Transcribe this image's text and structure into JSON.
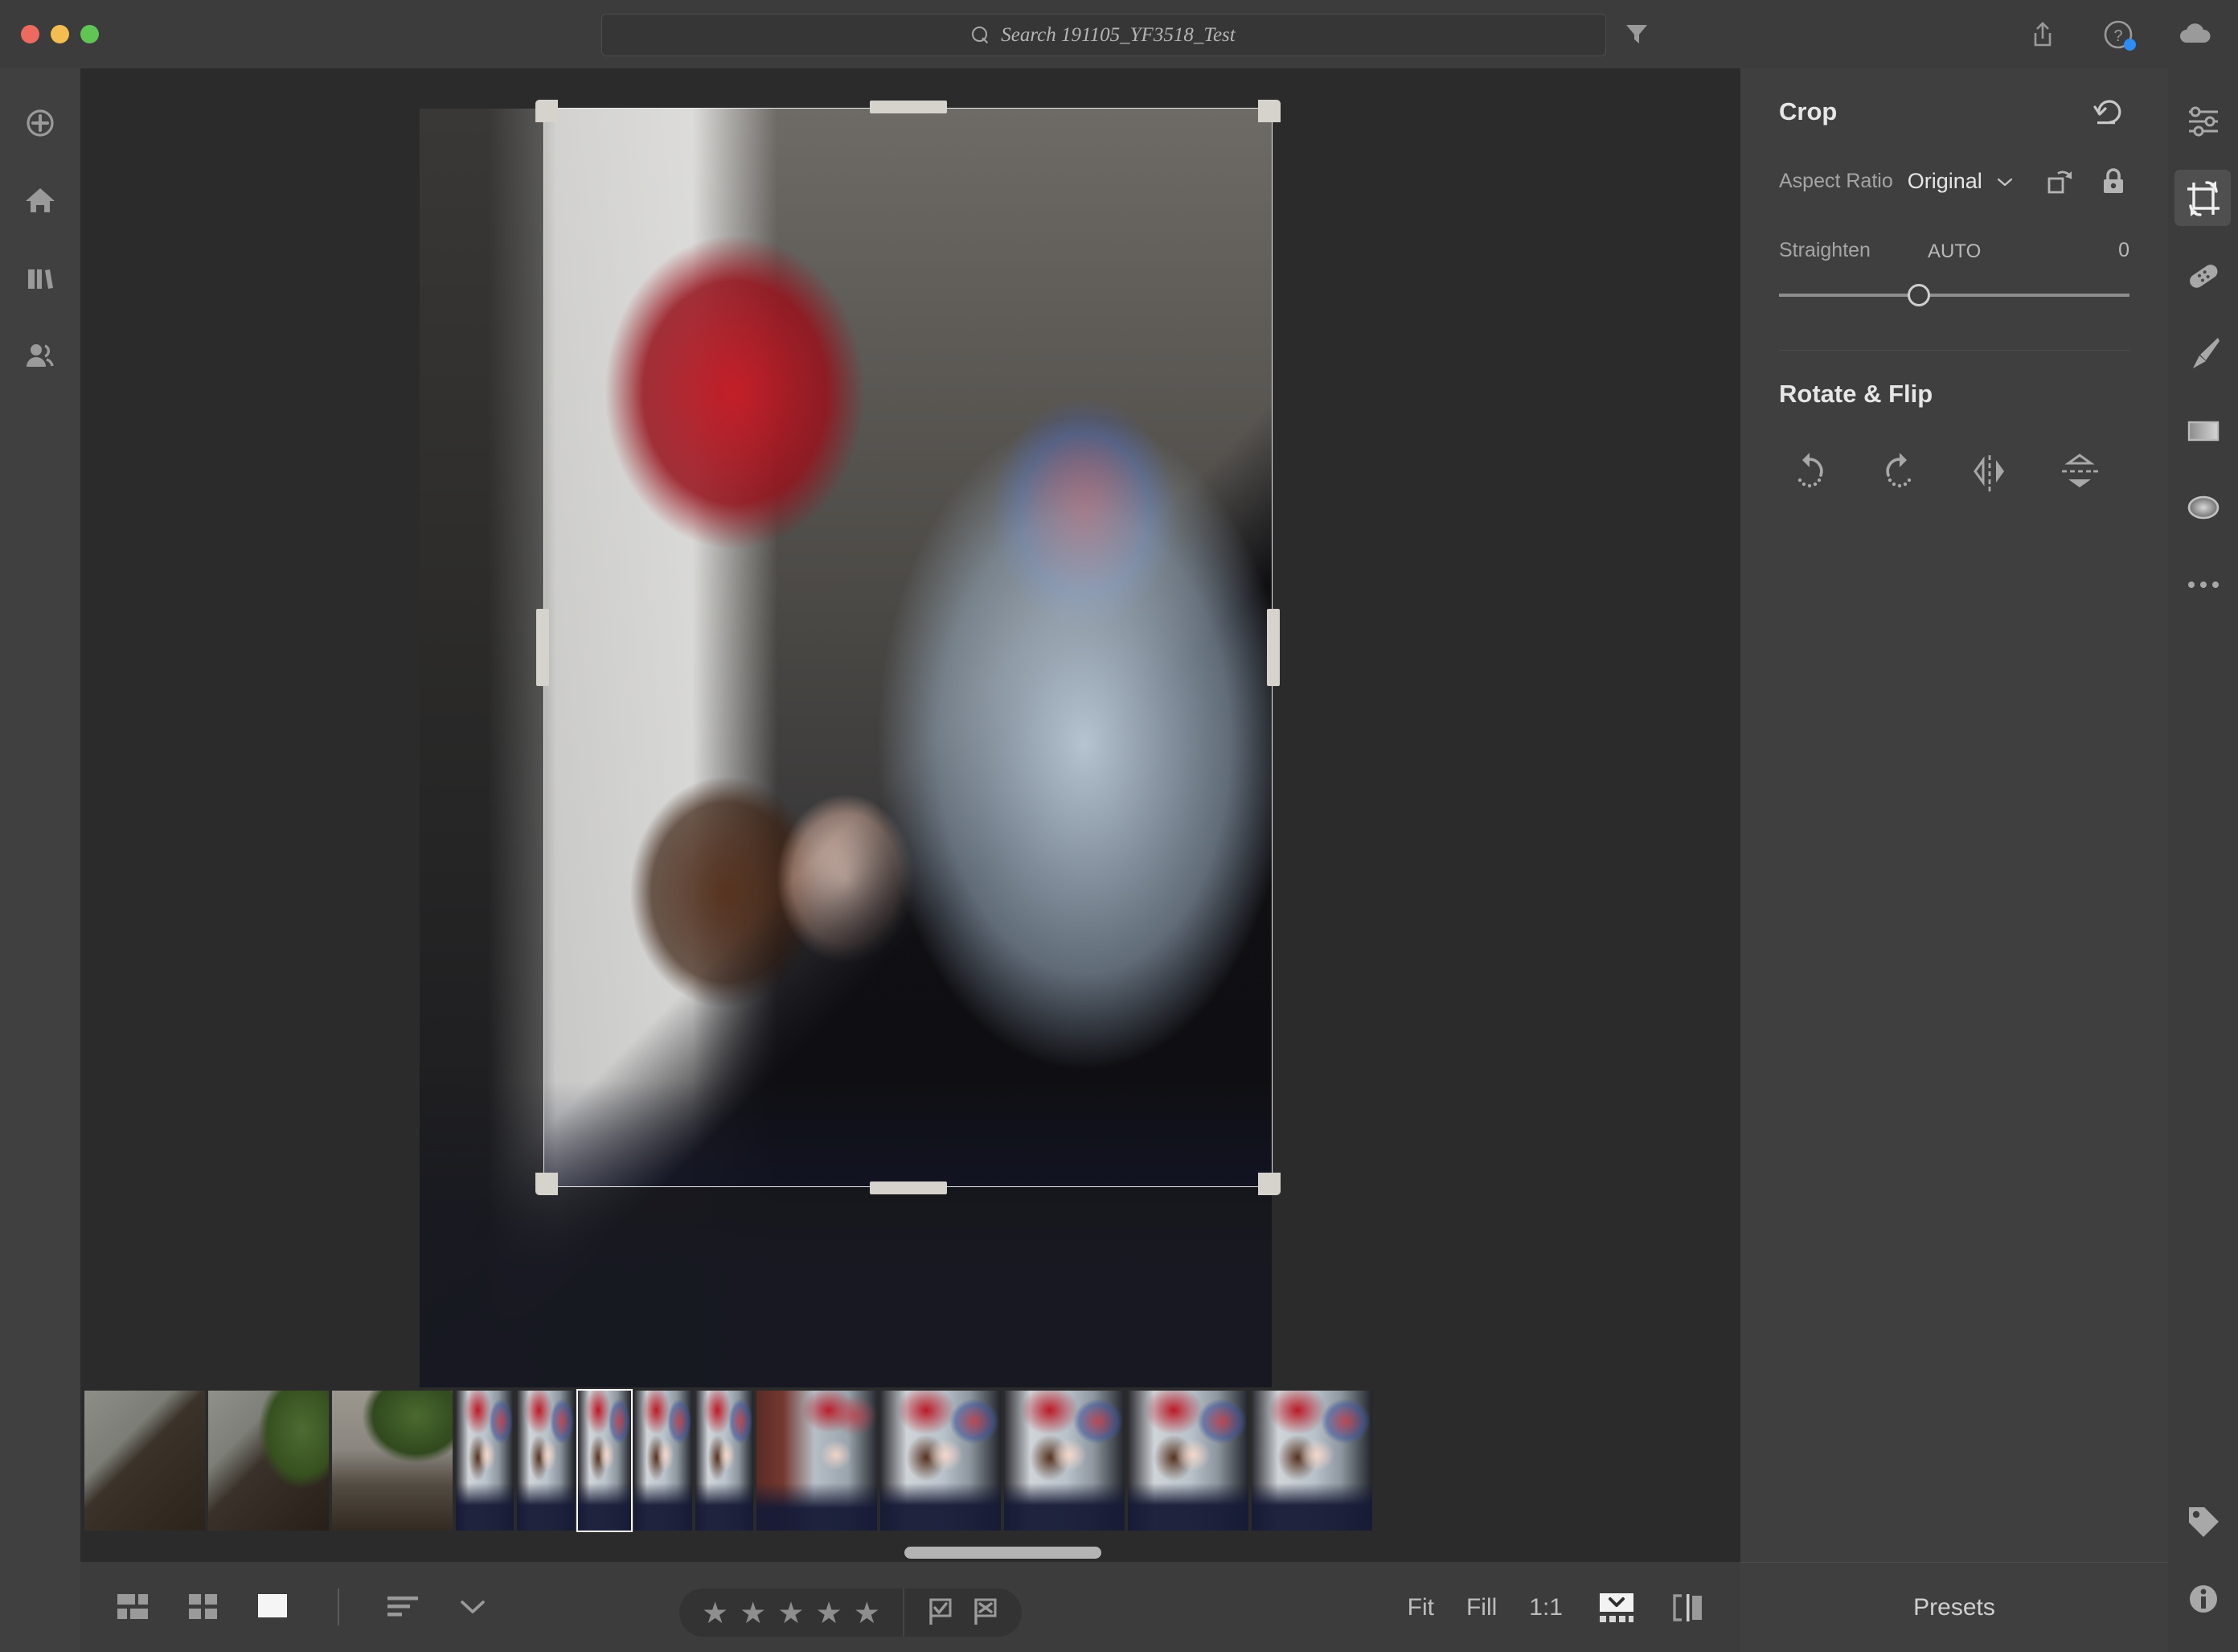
{
  "app": {
    "name": "Adobe Lightroom",
    "module": "Edit - Crop"
  },
  "titlebar": {
    "traffic_lights": [
      {
        "name": "close",
        "color": "#ec6a5f"
      },
      {
        "name": "minimize",
        "color": "#f4bd4f"
      },
      {
        "name": "maximize",
        "color": "#61c554"
      }
    ],
    "search": {
      "icon": "search-icon",
      "value": "Search 191105_YF3518_Test",
      "placeholder": "Search"
    },
    "filter_icon": "filter-funnel-icon",
    "actions": [
      {
        "name": "share-icon",
        "label": "Share"
      },
      {
        "name": "help-icon",
        "label": "Help",
        "badge": true,
        "badge_color": "#2d8cf7"
      },
      {
        "name": "cloud-icon",
        "label": "Cloud Sync"
      }
    ]
  },
  "left_rail": {
    "items": [
      {
        "name": "add-photos-icon",
        "label": "Add Photos",
        "active": false
      },
      {
        "name": "home-icon",
        "label": "Home",
        "active": false
      },
      {
        "name": "library-icon",
        "label": "Library",
        "active": false
      },
      {
        "name": "sharing-icon",
        "label": "Sharing",
        "active": false
      }
    ]
  },
  "canvas": {
    "crop_overlay": {
      "visible": true,
      "handles": [
        "top-left",
        "top-center",
        "top-right",
        "middle-left",
        "middle-right",
        "bottom-left",
        "bottom-center",
        "bottom-right"
      ]
    }
  },
  "filmstrip": {
    "selected_index": 5,
    "thumbnails": [
      {
        "name": "thumb-gravestone-1",
        "kind": "stone"
      },
      {
        "name": "thumb-gravestone-2",
        "kind": "stone-leaves"
      },
      {
        "name": "thumb-stone-bench",
        "kind": "bench"
      },
      {
        "name": "thumb-soldier-1",
        "kind": "soldier"
      },
      {
        "name": "thumb-soldier-2",
        "kind": "soldier"
      },
      {
        "name": "thumb-soldier-3-selected",
        "kind": "soldier"
      },
      {
        "name": "thumb-soldier-4",
        "kind": "soldier"
      },
      {
        "name": "thumb-soldier-5",
        "kind": "soldier"
      },
      {
        "name": "thumb-soldier-brick",
        "kind": "soldier-brick"
      },
      {
        "name": "thumb-soldier-6",
        "kind": "soldier"
      },
      {
        "name": "thumb-soldier-7",
        "kind": "soldier"
      },
      {
        "name": "thumb-soldier-8",
        "kind": "soldier"
      },
      {
        "name": "thumb-soldier-9",
        "kind": "soldier"
      }
    ]
  },
  "bottom_bar": {
    "view_modes": [
      {
        "name": "mosaic-view-icon",
        "label": "Mosaic View",
        "active": false
      },
      {
        "name": "grid-view-icon",
        "label": "Grid View",
        "active": false
      },
      {
        "name": "detail-view-icon",
        "label": "Detail View",
        "active": true
      }
    ],
    "sort_icon": "sort-icon",
    "sort_chevron": "chevron-down-icon",
    "rating": {
      "stars": 5,
      "filled": 0,
      "star_glyph": "★"
    },
    "flags": [
      {
        "name": "flag-picked-icon",
        "label": "Pick"
      },
      {
        "name": "flag-rejected-icon",
        "label": "Reject"
      }
    ],
    "zoom": {
      "fit_label": "Fit",
      "fill_label": "Fill",
      "one_to_one_label": "1:1",
      "selected": "Fit"
    },
    "filmstrip_toggle_icon": "filmstrip-toggle-icon",
    "compare_icon": "before-after-compare-icon"
  },
  "right_panel": {
    "crop": {
      "title": "Crop",
      "reset_icon": "reset-arrow-icon",
      "aspect_ratio_label": "Aspect Ratio",
      "aspect_ratio_value": "Original",
      "aspect_ratio_chevron": "chevron-down-icon",
      "rotate_crop_icon": "rotate-crop-icon",
      "lock_icon": "lock-closed-icon",
      "straighten_label": "Straighten",
      "straighten_auto_label": "AUTO",
      "straighten_value": "0",
      "straighten_slider_percent": 40
    },
    "rotate_flip": {
      "title": "Rotate & Flip",
      "buttons": [
        {
          "name": "rotate-left-icon",
          "label": "Rotate Left"
        },
        {
          "name": "rotate-right-icon",
          "label": "Rotate Right"
        },
        {
          "name": "flip-horizontal-icon",
          "label": "Flip Horizontal"
        },
        {
          "name": "flip-vertical-icon",
          "label": "Flip Vertical"
        }
      ]
    },
    "presets_label": "Presets"
  },
  "right_rail": {
    "items": [
      {
        "name": "edit-sliders-icon",
        "label": "Edit",
        "active": false
      },
      {
        "name": "crop-icon",
        "label": "Crop & Rotate",
        "active": true
      },
      {
        "name": "healing-brush-icon",
        "label": "Healing",
        "active": false
      },
      {
        "name": "brush-icon",
        "label": "Masking Brush",
        "active": false
      },
      {
        "name": "linear-gradient-icon",
        "label": "Linear Gradient",
        "active": false
      },
      {
        "name": "radial-gradient-icon",
        "label": "Radial Gradient",
        "active": false
      },
      {
        "name": "more-options-icon",
        "label": "More",
        "active": false
      }
    ],
    "bottom_items": [
      {
        "name": "tag-icon",
        "label": "Keywords"
      },
      {
        "name": "info-icon",
        "label": "Info"
      }
    ]
  },
  "colors": {
    "titlebar_bg": "#3c3c3c",
    "panel_bg": "#3f3f3f",
    "canvas_bg": "#2b2b2b",
    "rail_bg": "#404040",
    "accent_blue": "#2d8cf7",
    "icon_gray": "#9a9a9a",
    "text_primary": "#e6e6e6",
    "text_secondary": "#a5a5a5"
  }
}
